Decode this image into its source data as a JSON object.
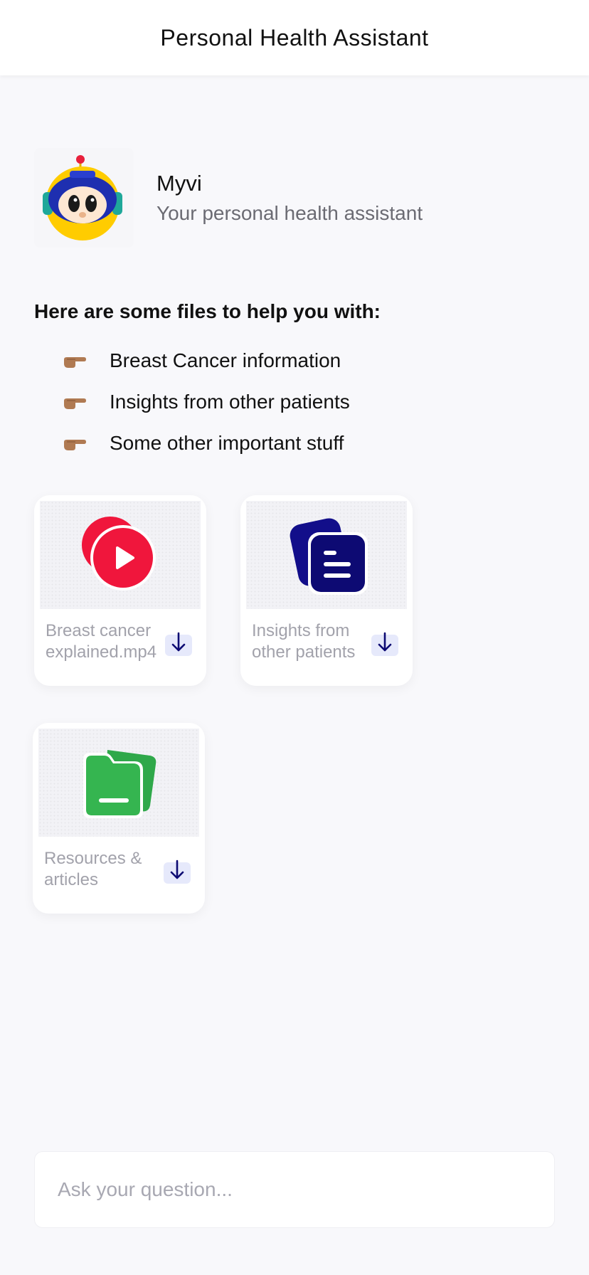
{
  "header": {
    "title": "Personal Health Assistant"
  },
  "assistant": {
    "name": "Myvi",
    "tagline": "Your personal health assistant",
    "avatar_icon": "robot-avatar-icon"
  },
  "intro": "Here are some files to help you with:",
  "bullets": [
    {
      "icon": "pointing-hand-icon",
      "label": "Breast Cancer information"
    },
    {
      "icon": "pointing-hand-icon",
      "label": "Insights from other patients"
    },
    {
      "icon": "pointing-hand-icon",
      "label": "Some other important stuff"
    }
  ],
  "files": [
    {
      "icon": "video-play-icon",
      "label": "Breast cancer explained.mp4",
      "color": "#f0163c"
    },
    {
      "icon": "document-icon",
      "label": "Insights from other patients",
      "color": "#0d0a73"
    },
    {
      "icon": "folder-icon",
      "label": "Resources & articles",
      "color": "#35b550"
    }
  ],
  "composer": {
    "placeholder": "Ask your question..."
  },
  "colors": {
    "accent": "#0d0a73",
    "video": "#f0163c",
    "folder": "#35b550",
    "download_bg": "#e6e9fb"
  }
}
